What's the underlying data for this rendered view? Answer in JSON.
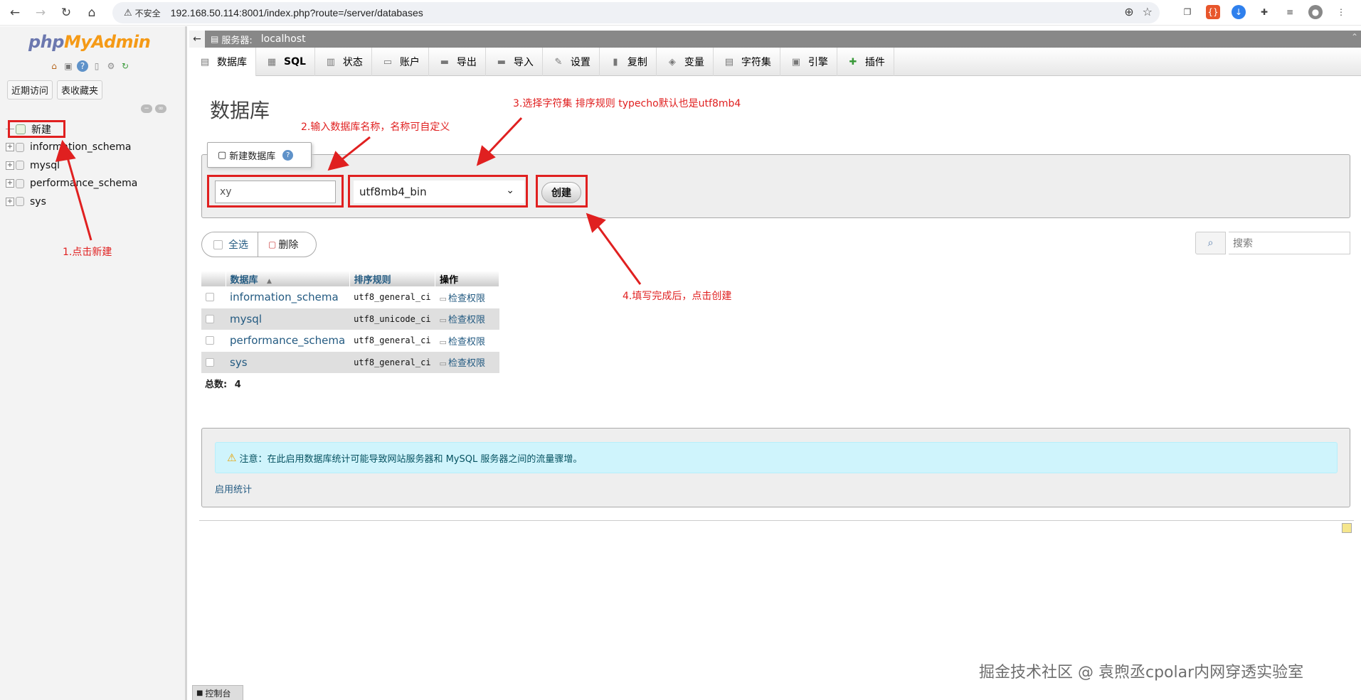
{
  "browser": {
    "insecure_label": "不安全",
    "url": "192.168.50.114:8001/index.php?route=/server/databases"
  },
  "sidebar": {
    "logo_php": "php",
    "logo_my": "MyAdmin",
    "recent_label": "近期访问",
    "favorites_label": "表收藏夹",
    "tree": [
      {
        "label": "新建"
      },
      {
        "label": "information_schema"
      },
      {
        "label": "mysql"
      },
      {
        "label": "performance_schema"
      },
      {
        "label": "sys"
      }
    ],
    "console_label": "控制台"
  },
  "server_bar": {
    "label": "服务器:",
    "host": "localhost"
  },
  "tabs": [
    {
      "label": "数据库",
      "icon": "database-icon"
    },
    {
      "label": "SQL",
      "icon": "sql-icon"
    },
    {
      "label": "状态",
      "icon": "status-icon"
    },
    {
      "label": "账户",
      "icon": "accounts-icon"
    },
    {
      "label": "导出",
      "icon": "export-icon"
    },
    {
      "label": "导入",
      "icon": "import-icon"
    },
    {
      "label": "设置",
      "icon": "settings-icon"
    },
    {
      "label": "复制",
      "icon": "replication-icon"
    },
    {
      "label": "变量",
      "icon": "variables-icon"
    },
    {
      "label": "字符集",
      "icon": "charset-icon"
    },
    {
      "label": "引擎",
      "icon": "engines-icon"
    },
    {
      "label": "插件",
      "icon": "plugins-icon"
    }
  ],
  "main": {
    "title": "数据库",
    "create_legend": "新建数据库",
    "db_name_value": "xy",
    "collation_value": "utf8mb4_bin",
    "create_button": "创建",
    "select_all": "全选",
    "delete_button": "删除",
    "search_placeholder": "搜索",
    "table": {
      "headers": [
        "数据库",
        "排序规则",
        "操作"
      ],
      "rows": [
        {
          "name": "information_schema",
          "collation": "utf8_general_ci",
          "action": "检查权限"
        },
        {
          "name": "mysql",
          "collation": "utf8_unicode_ci",
          "action": "检查权限"
        },
        {
          "name": "performance_schema",
          "collation": "utf8_general_ci",
          "action": "检查权限"
        },
        {
          "name": "sys",
          "collation": "utf8_general_ci",
          "action": "检查权限"
        }
      ]
    },
    "total_label": "总数:",
    "total_value": "4",
    "notice_text": "注意：在此启用数据库统计可能导致网站服务器和 MySQL 服务器之间的流量骤增。",
    "enable_stats": "启用统计"
  },
  "annotations": {
    "step1": "1.点击新建",
    "step2": "2.输入数据库名称，名称可自定义",
    "step3": "3.选择字符集 排序规则  typecho默认也是utf8mb4",
    "step4": "4.填写完成后，点击创建",
    "watermark": "掘金技术社区 @ 袁煦丞cpolar内网穿透实验室"
  },
  "colors": {
    "annotation_red": "#e02020",
    "link_blue": "#235a81",
    "notice_bg": "#cff4fc"
  }
}
